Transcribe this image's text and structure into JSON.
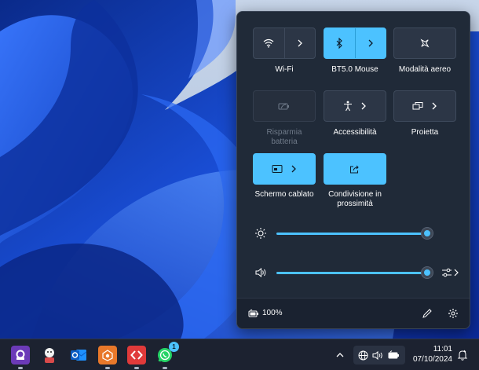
{
  "quick_settings": {
    "tiles": [
      {
        "id": "wifi",
        "label": "Wi-Fi",
        "icon": "wifi-icon",
        "state": "off",
        "has_arrow": true
      },
      {
        "id": "bluetooth",
        "label": "BT5.0 Mouse",
        "icon": "bluetooth-icon",
        "state": "on",
        "has_arrow": true
      },
      {
        "id": "airplane",
        "label": "Modalità aereo",
        "icon": "airplane-icon",
        "state": "off",
        "has_arrow": false
      },
      {
        "id": "battery-saver",
        "label_line1": "Risparmia",
        "label_line2": "batteria",
        "icon": "battery-saver-icon",
        "state": "disabled",
        "has_arrow": false
      },
      {
        "id": "accessibility",
        "label": "Accessibilità",
        "icon": "accessibility-icon",
        "state": "off",
        "has_arrow": true
      },
      {
        "id": "project",
        "label": "Proietta",
        "icon": "project-icon",
        "state": "off",
        "has_arrow": true
      },
      {
        "id": "cast",
        "label": "Schermo cablato",
        "icon": "cast-icon",
        "state": "on",
        "has_arrow": true
      },
      {
        "id": "nearby-share",
        "label_line1": "Condivisione in",
        "label_line2": "prossimità",
        "icon": "share-icon",
        "state": "on",
        "has_arrow": false
      }
    ],
    "brightness_level": 100,
    "volume_level": 100,
    "battery_text": "100%"
  },
  "taskbar": {
    "apps": [
      "pdf-app-icon",
      "character-app-icon",
      "outlook-icon",
      "notification-app-icon",
      "remote-app-icon",
      "whatsapp-icon"
    ],
    "whatsapp_badge": "1",
    "time": "11:01",
    "date": "07/10/2024"
  },
  "colors": {
    "accent": "#4cc2ff",
    "panel": "#202a38",
    "taskbar": "#1c2230"
  }
}
